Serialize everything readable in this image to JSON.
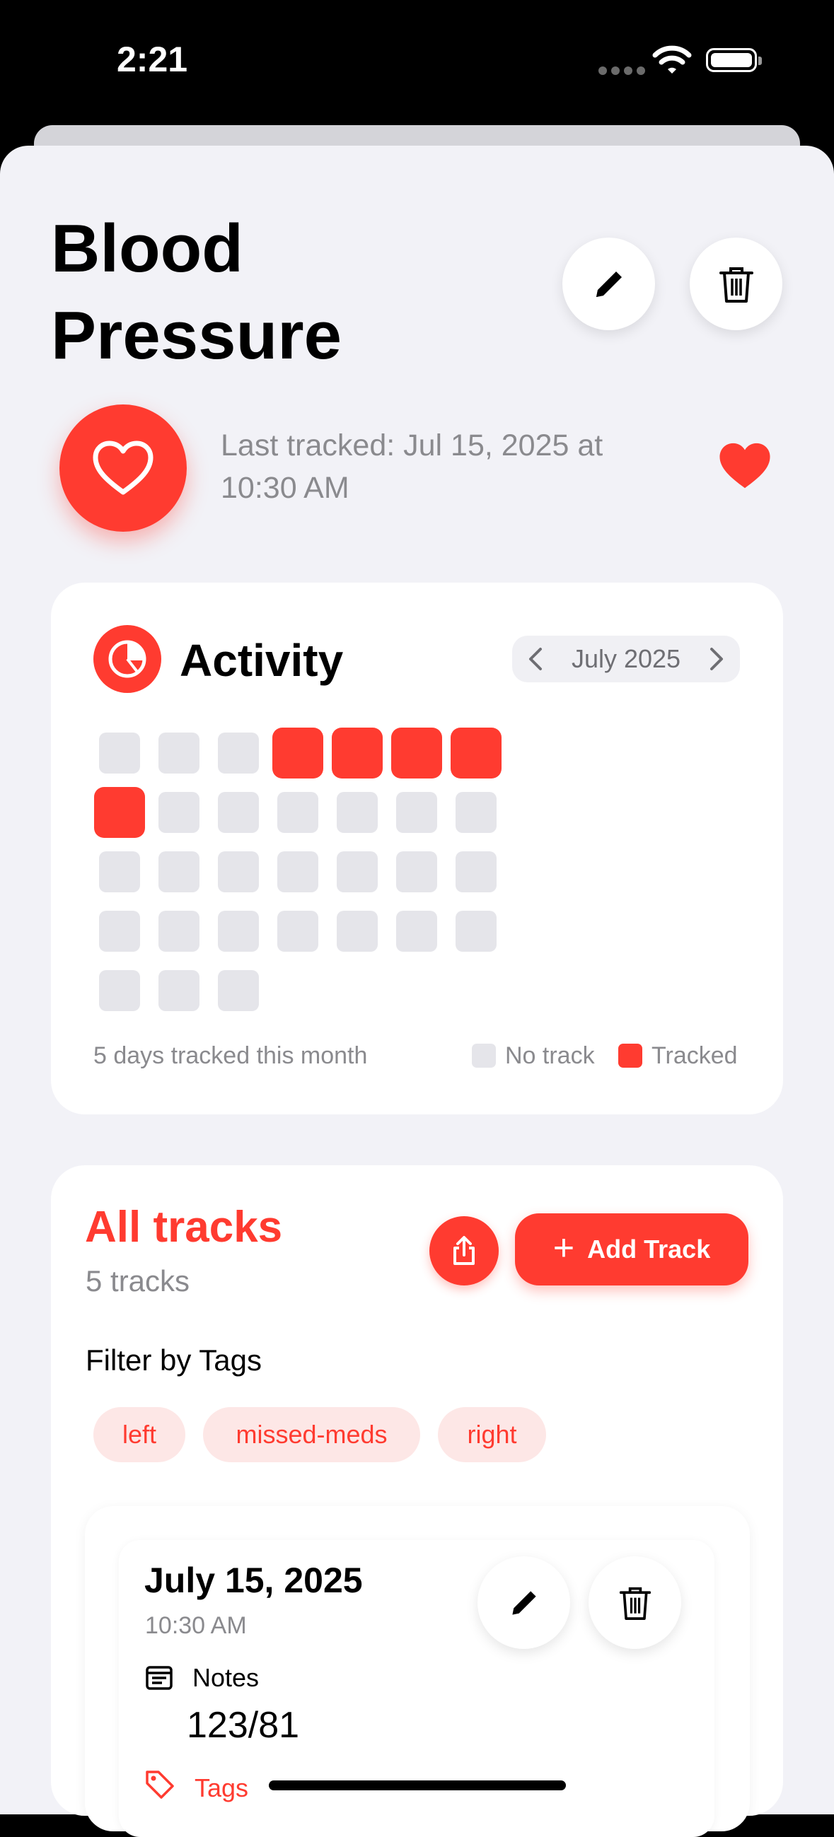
{
  "status_bar": {
    "time": "2:21"
  },
  "header": {
    "title": "Blood Pressure",
    "edit_icon": "pencil-icon",
    "delete_icon": "trash-icon"
  },
  "summary": {
    "last_tracked": "Last tracked: Jul 15, 2025 at 10:30 AM",
    "main_icon": "heart-outline-icon",
    "favorite_icon": "heart-filled-icon"
  },
  "activity": {
    "title": "Activity",
    "month": "July 2025",
    "summary": "5 days tracked this month",
    "legend": {
      "no_track": "No track",
      "tracked": "Tracked"
    },
    "tracked_days": [
      4,
      5,
      6,
      7,
      8
    ],
    "days_in_month": 31,
    "colors": {
      "tracked": "#FF3B30",
      "no_track": "#E5E5EA"
    }
  },
  "tracks": {
    "title": "All tracks",
    "count": "5 tracks",
    "add_label": "Add Track",
    "filter_label": "Filter by Tags",
    "tags": [
      "left",
      "missed-meds",
      "right"
    ],
    "entries": [
      {
        "date": "July 15, 2025",
        "time": "10:30 AM",
        "notes_label": "Notes",
        "notes_value": "123/81",
        "tags_label": "Tags"
      }
    ]
  },
  "colors": {
    "accent": "#FF3B30",
    "background": "#F2F2F7"
  }
}
